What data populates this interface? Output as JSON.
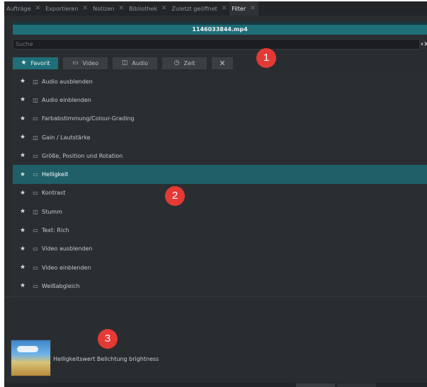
{
  "tabs": [
    {
      "label": "Aufträge",
      "active": false
    },
    {
      "label": "Exportieren",
      "active": false
    },
    {
      "label": "Notizen",
      "active": false
    },
    {
      "label": "Bibliothek",
      "active": false
    },
    {
      "label": "Zuletzt geöffnet",
      "active": false
    },
    {
      "label": "Filter",
      "active": true
    }
  ],
  "title": "1146033844.mp4",
  "search": {
    "placeholder": "Suche",
    "value": ""
  },
  "filters": {
    "favorite": "Favorit",
    "video": "Video",
    "audio": "Audio",
    "time": "Zeit",
    "clear": "✕"
  },
  "markers": [
    "1",
    "2",
    "3"
  ],
  "items": [
    {
      "kind": "audio",
      "label": "Audio ausblenden"
    },
    {
      "kind": "audio",
      "label": "Audio einblenden"
    },
    {
      "kind": "video",
      "label": "Farbabstimmung/Colour-Grading"
    },
    {
      "kind": "audio",
      "label": "Gain / Lautstärke"
    },
    {
      "kind": "video",
      "label": "Größe, Position und Rotation"
    },
    {
      "kind": "video",
      "label": "Helligkeit",
      "selected": true
    },
    {
      "kind": "video",
      "label": "Kontrast"
    },
    {
      "kind": "audio",
      "label": "Stumm"
    },
    {
      "kind": "video",
      "label": "Text: Rich"
    },
    {
      "kind": "video",
      "label": "Video ausblenden"
    },
    {
      "kind": "video",
      "label": "Video einblenden"
    },
    {
      "kind": "video",
      "label": "Weißabgleich"
    }
  ],
  "description": "Helligkeitswert Belichtung brightness",
  "colors": {
    "accent": "#1e6f79",
    "selected_row": "#1e5f68",
    "marker": "#e53935",
    "background": "#2a2d30"
  }
}
